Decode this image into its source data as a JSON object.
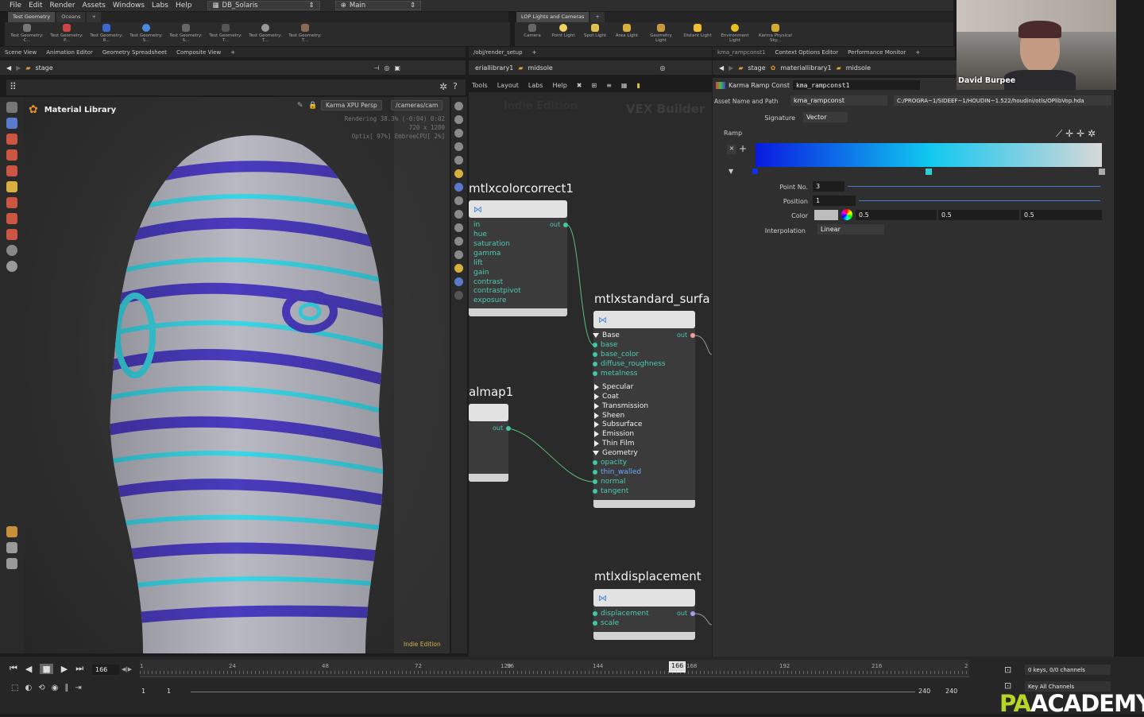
{
  "menubar": {
    "items": [
      "File",
      "Edit",
      "Render",
      "Assets",
      "Windows",
      "Labs",
      "Help"
    ],
    "desktop": "DB_Solaris",
    "context": "Main"
  },
  "shelf_left": {
    "tabs": [
      "Test Geometry",
      "Oceans"
    ],
    "tools": [
      "Test Geometry: C...",
      "Test Geometry: P...",
      "Test Geometry: R...",
      "Test Geometry: S...",
      "Test Geometry: S...",
      "Test Geometry: T...",
      "Test Geometry: T...",
      "Test Geometry: T..."
    ]
  },
  "shelf_right": {
    "tabs": [
      "LOP Lights and Cameras"
    ],
    "tools": [
      "Camera",
      "Point Light",
      "Spot Light",
      "Area Light",
      "Geometry Light",
      "Distant Light",
      "Environment Light",
      "Karma Physical Sky..."
    ]
  },
  "left_pane": {
    "tabs": [
      "Scene View",
      "Animation Editor",
      "Geometry Spreadsheet",
      "Composite View"
    ],
    "path": "stage",
    "viewport_title": "Material Library",
    "renderer": "Karma XPU Persp",
    "camera": "/cameras/cam",
    "stats": [
      "Rendering  38.3%   (-0:04)  0:02",
      "720 x 1280",
      "Optix[ 97%] EmbreeCPU[  2%]"
    ],
    "edition": "Indie Edition"
  },
  "mid_pane": {
    "tab": "/obj/render_setup",
    "path_a": "eriallibrary1",
    "path_b": "midsole",
    "menu": [
      "Tools",
      "Layout",
      "Labs",
      "Help"
    ],
    "watermark_edition": "Indie Edition",
    "watermark_context": "VEX Builder",
    "nodes": {
      "colorcorrect": {
        "title": "mtlxcolorcorrect1",
        "inputs": [
          "in",
          "hue",
          "saturation",
          "gamma",
          "lift",
          "gain",
          "contrast",
          "contrastpivot",
          "exposure"
        ],
        "out": "out"
      },
      "normalmap": {
        "title": "almap1",
        "out": "out"
      },
      "standard": {
        "title": "mtlxstandard_surfa",
        "section_base": "Base",
        "base_inputs": [
          "base",
          "base_color",
          "diffuse_roughness",
          "metalness"
        ],
        "sections": [
          "Specular",
          "Coat",
          "Transmission",
          "Sheen",
          "Subsurface",
          "Emission",
          "Thin Film"
        ],
        "section_geometry": "Geometry",
        "geometry_inputs": [
          "opacity",
          "thin_walled",
          "normal",
          "tangent"
        ],
        "out": "out"
      },
      "displacement": {
        "title": "mtlxdisplacement",
        "inputs": [
          "displacement",
          "scale"
        ],
        "out": "out"
      }
    }
  },
  "right_pane": {
    "tabs": [
      "kma_rampconst1",
      "Context Options Editor",
      "Performance Monitor"
    ],
    "path": [
      "stage",
      "materiallibrary1",
      "midsole"
    ],
    "node_type": "Karma Ramp Const",
    "node_name": "kma_rampconst1",
    "asset_label": "Asset Name and Path",
    "asset_name": "kma_rampconst",
    "asset_path": "C:/PROGRA~1/SIDEEF~1/HOUDIN~1.522/houdini/otls/OPlibVop.hda",
    "signature_label": "Signature",
    "signature": "Vector",
    "ramp_label": "Ramp",
    "point_no_label": "Point No.",
    "point_no": "3",
    "position_label": "Position",
    "position": "1",
    "color_label": "Color",
    "color_values": [
      "0.5",
      "0.5",
      "0.5"
    ],
    "interp_label": "Interpolation",
    "interp": "Linear",
    "ramp_colors": [
      "#0a1ae0",
      "#10c8f0",
      "#d8d8d8"
    ]
  },
  "timeline": {
    "frame": "166",
    "ticks": [
      "1",
      "24",
      "48",
      "72",
      "96",
      "120",
      "144",
      "168",
      "192",
      "216",
      "2"
    ],
    "start_a": "1",
    "start_b": "1",
    "end_a": "240",
    "end_b": "240",
    "keys": "0 keys, 0/0 channels",
    "key_all": "Key All Channels"
  },
  "webcam": {
    "name": "David Burpee"
  },
  "logo": {
    "pa": "PA",
    "academy": "ACADEMY"
  },
  "colors": {
    "accent_teal": "#3fc9a5",
    "sculpt_purple": "#4a3bbf",
    "sculpt_cyan": "#3ad6e6"
  }
}
